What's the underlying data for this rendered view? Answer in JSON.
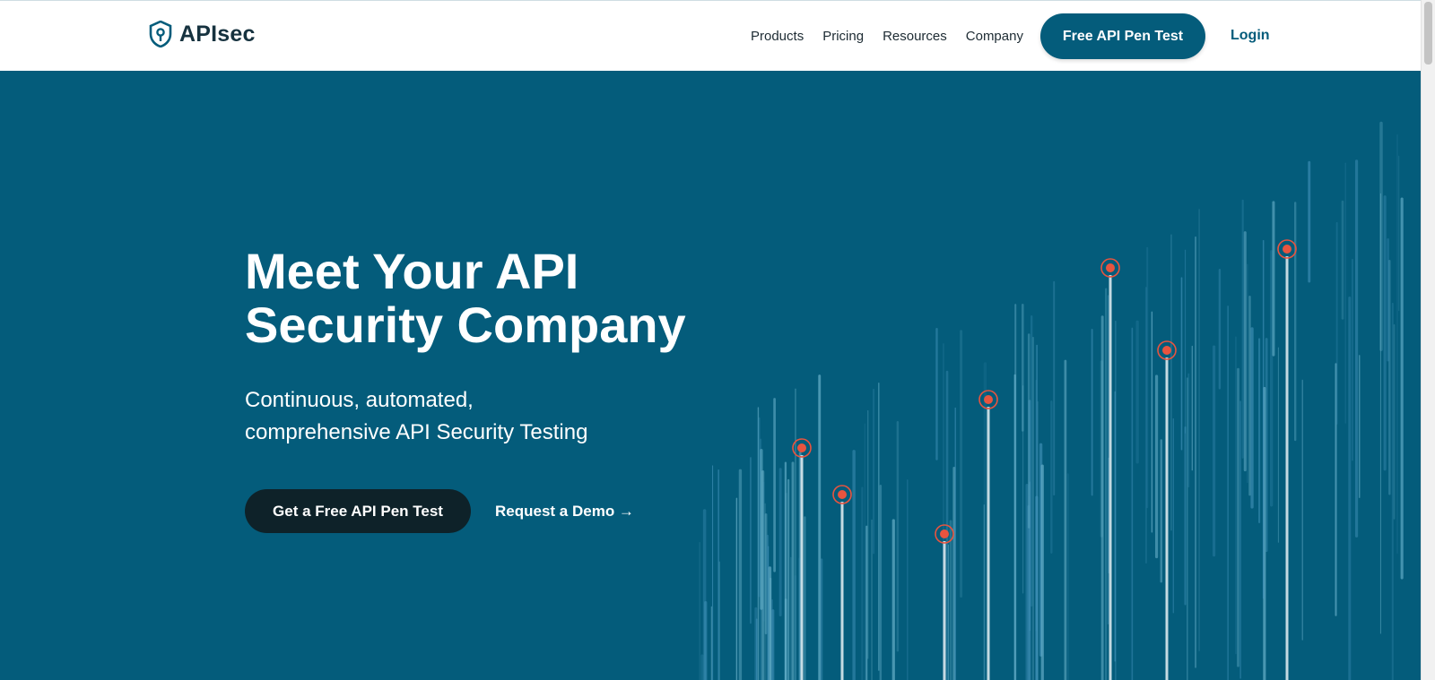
{
  "brand": {
    "name": "APIsec",
    "logo_icon": "shield-lock-icon"
  },
  "nav": {
    "links": [
      "Products",
      "Pricing",
      "Resources",
      "Company"
    ],
    "cta_label": "Free API Pen Test",
    "login_label": "Login"
  },
  "hero": {
    "title_line1": "Meet Your API",
    "title_line2": "Security Company",
    "subtitle_line1": "Continuous, automated,",
    "subtitle_line2": "comprehensive API Security Testing",
    "primary_cta": "Get a Free API Pen Test",
    "secondary_cta": "Request a Demo →"
  },
  "colors": {
    "hero_background": "#045c7b",
    "primary_button": "#0e2229",
    "marker_red": "#e8543f",
    "nav_background": "#ffffff"
  }
}
